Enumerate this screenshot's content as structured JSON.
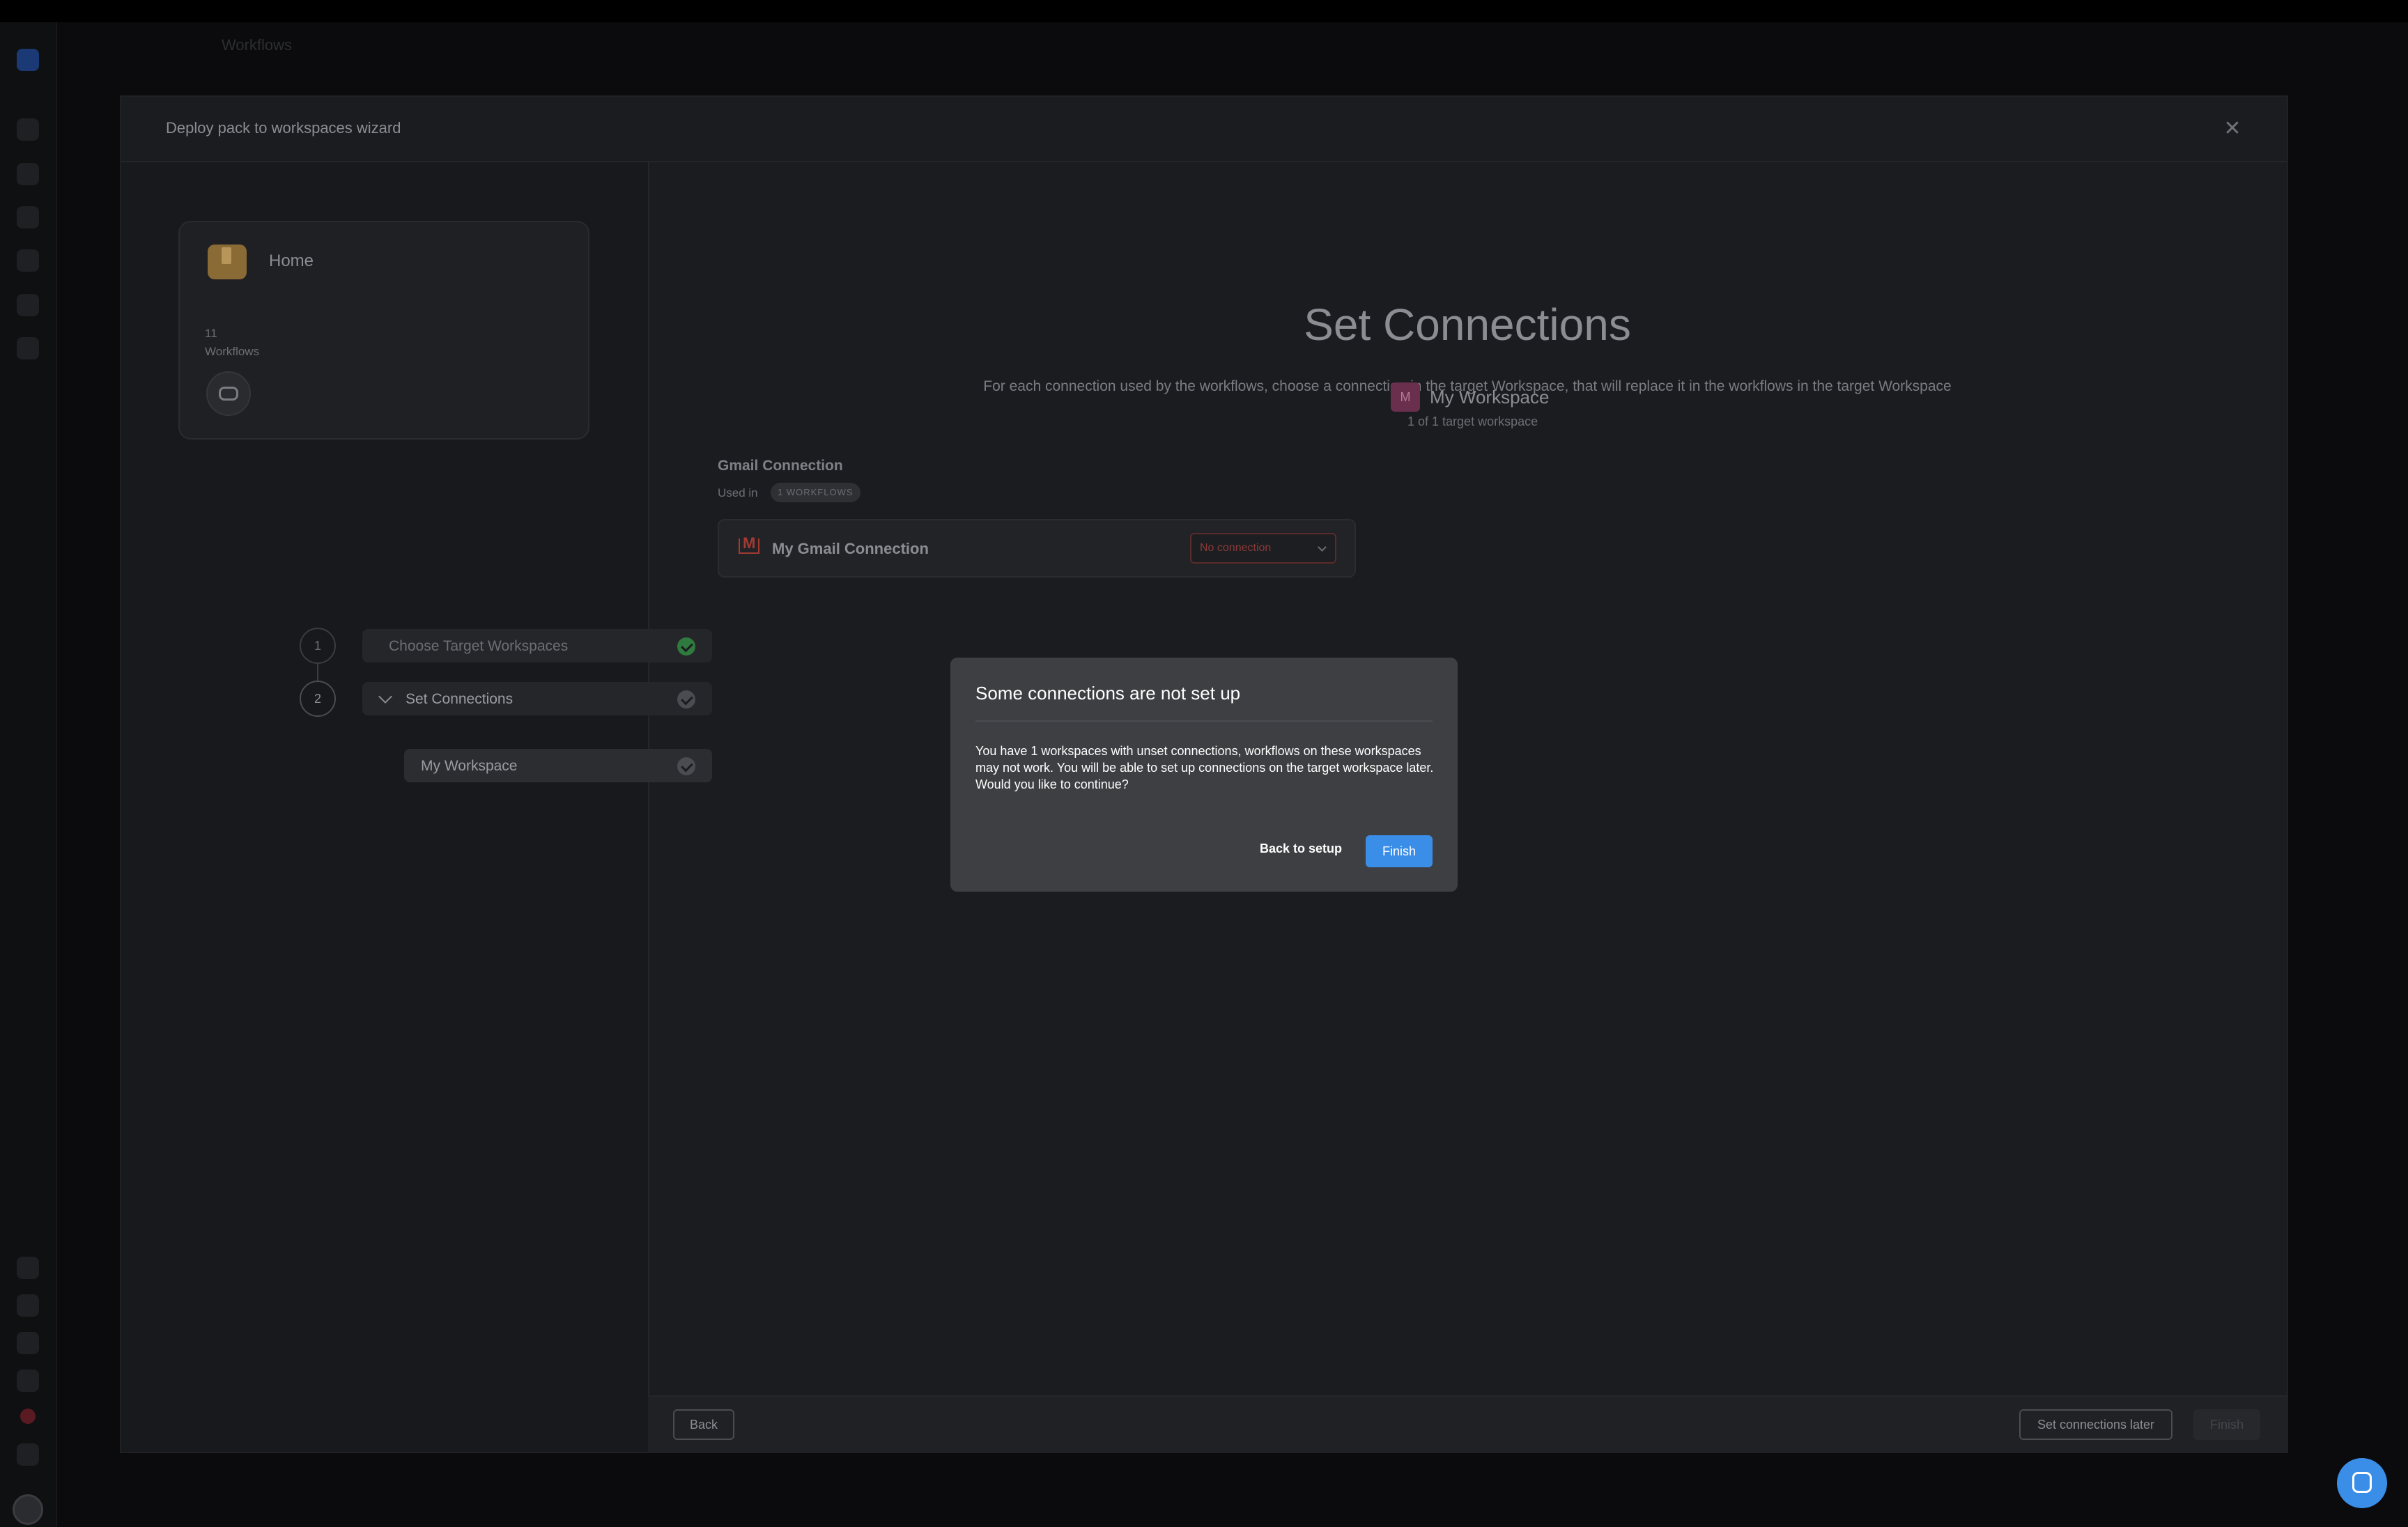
{
  "app": {
    "page_title": "Workflows"
  },
  "wizard": {
    "title": "Deploy pack to workspaces wizard",
    "close_icon": "close-icon",
    "pack": {
      "name": "Home",
      "workflow_count": "11",
      "workflow_label": "Workflows"
    },
    "steps": [
      {
        "number": "1",
        "label": "Choose Target Workspaces",
        "status": "complete"
      },
      {
        "number": "2",
        "label": "Set Connections",
        "status": "in-progress"
      }
    ],
    "substep": {
      "label": "My Workspace"
    },
    "main": {
      "title": "Set Connections",
      "description": "For each connection used by the workflows, choose a connection in the target Workspace, that will replace it in the workflows in the target Workspace",
      "workspace": {
        "initial": "M",
        "name": "My Workspace",
        "subtitle": "1 of 1 target workspace",
        "badge_color": "#6a2f4d"
      },
      "connection_group": {
        "title": "Gmail Connection",
        "used_in_label": "Used in",
        "used_in_tag": "1 WORKFLOWS",
        "connection_name": "My Gmail Connection",
        "select_value": "No connection"
      }
    },
    "footer": {
      "back": "Back",
      "set_later": "Set connections later",
      "finish": "Finish"
    }
  },
  "modal": {
    "title": "Some connections are not set up",
    "body": "You have 1 workspaces with unset connections, workflows on these workspaces may not work. You will be able to set up connections on the target workspace later. Would you like to continue?",
    "back_button": "Back to setup",
    "finish_button": "Finish",
    "accent_color": "#3b8ee8"
  }
}
